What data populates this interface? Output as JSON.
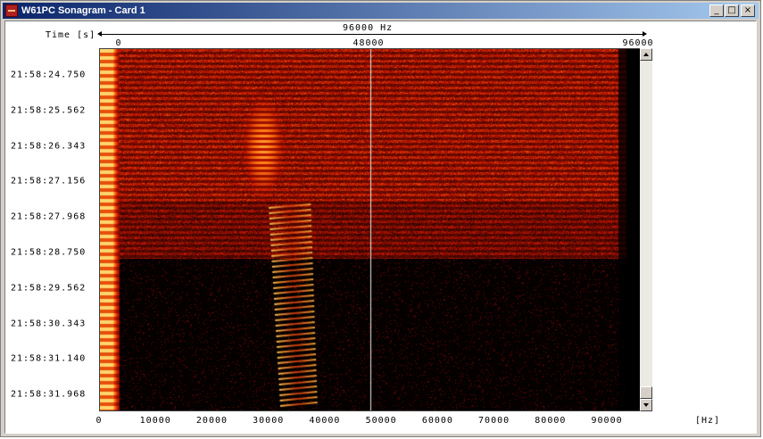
{
  "window": {
    "title": "W61PC Sonagram  - Card 1",
    "controls": {
      "minimize": "_",
      "maximize": "□",
      "close": "×"
    }
  },
  "sonagram": {
    "time_axis_label": "Time [s]",
    "bandwidth_label": "96000 Hz",
    "top_scale": [
      "0",
      "48000",
      "96000"
    ],
    "time_labels": [
      "21:58:24.750",
      "21:58:25.562",
      "21:58:26.343",
      "21:58:27.156",
      "21:58:27.968",
      "21:58:28.750",
      "21:58:29.562",
      "21:58:30.343",
      "21:58:31.140",
      "21:58:31.968"
    ],
    "freq_ticks": [
      "0",
      "10000",
      "20000",
      "30000",
      "40000",
      "50000",
      "60000",
      "70000",
      "80000",
      "90000"
    ],
    "freq_unit": "[Hz]",
    "marker_hz": 48000,
    "colors": {
      "background": "#000000",
      "low": "#5a0a04",
      "mid": "#c82a0a",
      "high": "#ffd060"
    }
  }
}
